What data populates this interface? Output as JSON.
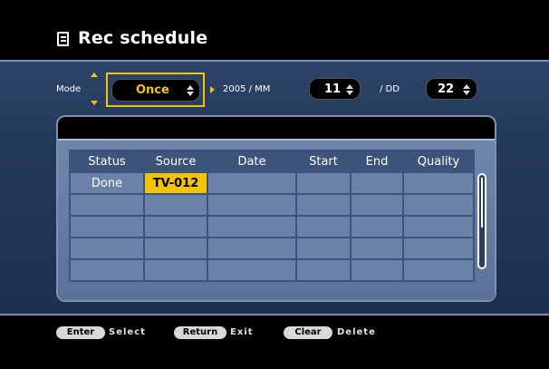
{
  "header": {
    "title": "Rec schedule"
  },
  "mode": {
    "label": "Mode",
    "value": "Once"
  },
  "date": {
    "year_mm_label": "2005 / MM",
    "month": "11",
    "dd_label": "/ DD",
    "day": "22"
  },
  "table": {
    "columns": [
      "Status",
      "Source",
      "Date",
      "Start",
      "End",
      "Quality"
    ],
    "rows": [
      [
        "Done",
        "TV-012",
        "",
        "",
        "",
        ""
      ],
      [
        "",
        "",
        "",
        "",
        "",
        ""
      ],
      [
        "",
        "",
        "",
        "",
        "",
        ""
      ],
      [
        "",
        "",
        "",
        "",
        "",
        ""
      ],
      [
        "",
        "",
        "",
        "",
        "",
        ""
      ]
    ]
  },
  "footer": {
    "keys": [
      {
        "key": "Enter",
        "label": "Select"
      },
      {
        "key": "Return",
        "label": "Exit"
      },
      {
        "key": "Clear",
        "label": "Delete"
      }
    ]
  },
  "colors": {
    "accent": "#f3c400",
    "background": "#243a5c",
    "header_bg": "#000000"
  }
}
